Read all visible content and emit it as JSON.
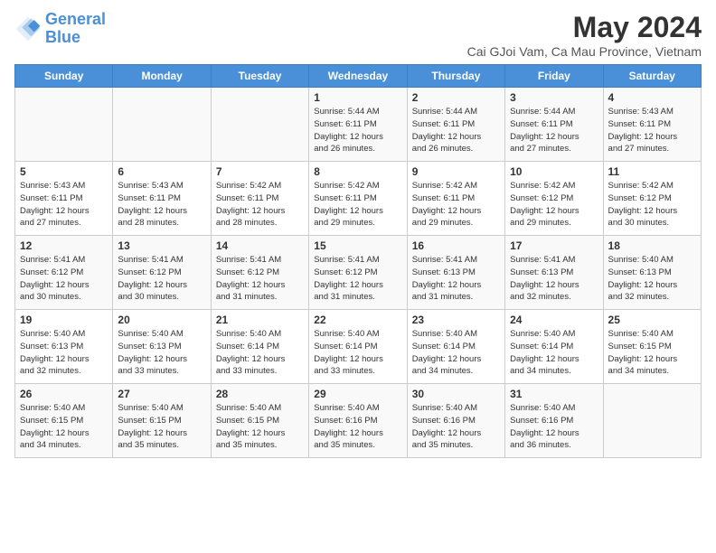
{
  "header": {
    "logo_general": "General",
    "logo_blue": "Blue",
    "title": "May 2024",
    "subtitle": "Cai GJoi Vam, Ca Mau Province, Vietnam"
  },
  "weekdays": [
    "Sunday",
    "Monday",
    "Tuesday",
    "Wednesday",
    "Thursday",
    "Friday",
    "Saturday"
  ],
  "weeks": [
    [
      {
        "day": "",
        "info": ""
      },
      {
        "day": "",
        "info": ""
      },
      {
        "day": "",
        "info": ""
      },
      {
        "day": "1",
        "info": "Sunrise: 5:44 AM\nSunset: 6:11 PM\nDaylight: 12 hours\nand 26 minutes."
      },
      {
        "day": "2",
        "info": "Sunrise: 5:44 AM\nSunset: 6:11 PM\nDaylight: 12 hours\nand 26 minutes."
      },
      {
        "day": "3",
        "info": "Sunrise: 5:44 AM\nSunset: 6:11 PM\nDaylight: 12 hours\nand 27 minutes."
      },
      {
        "day": "4",
        "info": "Sunrise: 5:43 AM\nSunset: 6:11 PM\nDaylight: 12 hours\nand 27 minutes."
      }
    ],
    [
      {
        "day": "5",
        "info": "Sunrise: 5:43 AM\nSunset: 6:11 PM\nDaylight: 12 hours\nand 27 minutes."
      },
      {
        "day": "6",
        "info": "Sunrise: 5:43 AM\nSunset: 6:11 PM\nDaylight: 12 hours\nand 28 minutes."
      },
      {
        "day": "7",
        "info": "Sunrise: 5:42 AM\nSunset: 6:11 PM\nDaylight: 12 hours\nand 28 minutes."
      },
      {
        "day": "8",
        "info": "Sunrise: 5:42 AM\nSunset: 6:11 PM\nDaylight: 12 hours\nand 29 minutes."
      },
      {
        "day": "9",
        "info": "Sunrise: 5:42 AM\nSunset: 6:11 PM\nDaylight: 12 hours\nand 29 minutes."
      },
      {
        "day": "10",
        "info": "Sunrise: 5:42 AM\nSunset: 6:12 PM\nDaylight: 12 hours\nand 29 minutes."
      },
      {
        "day": "11",
        "info": "Sunrise: 5:42 AM\nSunset: 6:12 PM\nDaylight: 12 hours\nand 30 minutes."
      }
    ],
    [
      {
        "day": "12",
        "info": "Sunrise: 5:41 AM\nSunset: 6:12 PM\nDaylight: 12 hours\nand 30 minutes."
      },
      {
        "day": "13",
        "info": "Sunrise: 5:41 AM\nSunset: 6:12 PM\nDaylight: 12 hours\nand 30 minutes."
      },
      {
        "day": "14",
        "info": "Sunrise: 5:41 AM\nSunset: 6:12 PM\nDaylight: 12 hours\nand 31 minutes."
      },
      {
        "day": "15",
        "info": "Sunrise: 5:41 AM\nSunset: 6:12 PM\nDaylight: 12 hours\nand 31 minutes."
      },
      {
        "day": "16",
        "info": "Sunrise: 5:41 AM\nSunset: 6:13 PM\nDaylight: 12 hours\nand 31 minutes."
      },
      {
        "day": "17",
        "info": "Sunrise: 5:41 AM\nSunset: 6:13 PM\nDaylight: 12 hours\nand 32 minutes."
      },
      {
        "day": "18",
        "info": "Sunrise: 5:40 AM\nSunset: 6:13 PM\nDaylight: 12 hours\nand 32 minutes."
      }
    ],
    [
      {
        "day": "19",
        "info": "Sunrise: 5:40 AM\nSunset: 6:13 PM\nDaylight: 12 hours\nand 32 minutes."
      },
      {
        "day": "20",
        "info": "Sunrise: 5:40 AM\nSunset: 6:13 PM\nDaylight: 12 hours\nand 33 minutes."
      },
      {
        "day": "21",
        "info": "Sunrise: 5:40 AM\nSunset: 6:14 PM\nDaylight: 12 hours\nand 33 minutes."
      },
      {
        "day": "22",
        "info": "Sunrise: 5:40 AM\nSunset: 6:14 PM\nDaylight: 12 hours\nand 33 minutes."
      },
      {
        "day": "23",
        "info": "Sunrise: 5:40 AM\nSunset: 6:14 PM\nDaylight: 12 hours\nand 34 minutes."
      },
      {
        "day": "24",
        "info": "Sunrise: 5:40 AM\nSunset: 6:14 PM\nDaylight: 12 hours\nand 34 minutes."
      },
      {
        "day": "25",
        "info": "Sunrise: 5:40 AM\nSunset: 6:15 PM\nDaylight: 12 hours\nand 34 minutes."
      }
    ],
    [
      {
        "day": "26",
        "info": "Sunrise: 5:40 AM\nSunset: 6:15 PM\nDaylight: 12 hours\nand 34 minutes."
      },
      {
        "day": "27",
        "info": "Sunrise: 5:40 AM\nSunset: 6:15 PM\nDaylight: 12 hours\nand 35 minutes."
      },
      {
        "day": "28",
        "info": "Sunrise: 5:40 AM\nSunset: 6:15 PM\nDaylight: 12 hours\nand 35 minutes."
      },
      {
        "day": "29",
        "info": "Sunrise: 5:40 AM\nSunset: 6:16 PM\nDaylight: 12 hours\nand 35 minutes."
      },
      {
        "day": "30",
        "info": "Sunrise: 5:40 AM\nSunset: 6:16 PM\nDaylight: 12 hours\nand 35 minutes."
      },
      {
        "day": "31",
        "info": "Sunrise: 5:40 AM\nSunset: 6:16 PM\nDaylight: 12 hours\nand 36 minutes."
      },
      {
        "day": "",
        "info": ""
      }
    ]
  ]
}
